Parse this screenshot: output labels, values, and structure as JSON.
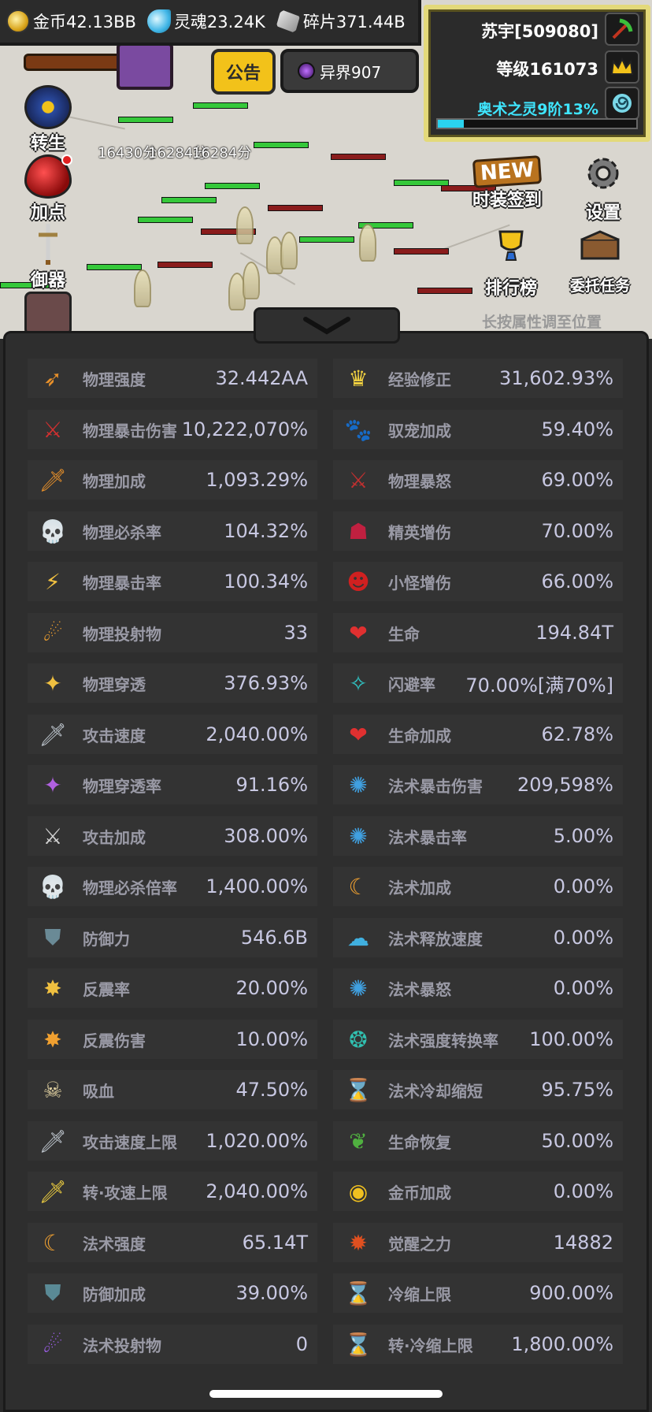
{
  "resources": {
    "gold": "金币42.13BB",
    "soul": "灵魂23.24K",
    "fragment": "碎片371.44B"
  },
  "player": {
    "name": "苏宇[509080]",
    "level": "等级161073",
    "arcane": "奥术之灵9阶13%",
    "arcane_progress": 0.13
  },
  "buttons": {
    "notice": "公告",
    "realm": "异界907",
    "rebirth": "转生",
    "add_points": "加点",
    "weapon": "御器",
    "new_tag": "NEW",
    "fashion_signin": "时装签到",
    "settings": "设置",
    "ranking": "排行榜",
    "commission": "委托任务"
  },
  "scene": {
    "damage_texts": [
      "16430分",
      "16284分",
      "16284分"
    ],
    "hint": "长按属性调至位置"
  },
  "stats_left": [
    {
      "icon": "phys-strength-icon",
      "glyph": "➶",
      "color": "#e8902a",
      "label": "物理强度",
      "value": "32.442AA"
    },
    {
      "icon": "phys-crit-damage-icon",
      "glyph": "⚔",
      "color": "#d03030",
      "label": "物理暴击伤害",
      "value": "10,222,070%"
    },
    {
      "icon": "phys-bonus-icon",
      "glyph": "🗡",
      "color": "#e8902a",
      "label": "物理加成",
      "value": "1,093.29%"
    },
    {
      "icon": "phys-kill-rate-icon",
      "glyph": "💀",
      "color": "#e0d0a0",
      "label": "物理必杀率",
      "value": "104.32%"
    },
    {
      "icon": "phys-crit-rate-icon",
      "glyph": "⚡",
      "color": "#f0c040",
      "label": "物理暴击率",
      "value": "100.34%"
    },
    {
      "icon": "phys-projectile-icon",
      "glyph": "☄",
      "color": "#f0a030",
      "label": "物理投射物",
      "value": "33"
    },
    {
      "icon": "phys-penetration-icon",
      "glyph": "✦",
      "color": "#f0c040",
      "label": "物理穿透",
      "value": "376.93%"
    },
    {
      "icon": "attack-speed-icon",
      "glyph": "🗡",
      "color": "#c0c8d0",
      "label": "攻击速度",
      "value": "2,040.00%"
    },
    {
      "icon": "phys-pen-rate-icon",
      "glyph": "✦",
      "color": "#b060e0",
      "label": "物理穿透率",
      "value": "91.16%"
    },
    {
      "icon": "attack-bonus-icon",
      "glyph": "⚔",
      "color": "#d0d0d0",
      "label": "攻击加成",
      "value": "308.00%"
    },
    {
      "icon": "phys-kill-multiplier-icon",
      "glyph": "💀",
      "color": "#e0d0a0",
      "label": "物理必杀倍率",
      "value": "1,400.00%"
    },
    {
      "icon": "defense-icon",
      "glyph": "⛊",
      "color": "#6a8a96",
      "label": "防御力",
      "value": "546.6B"
    },
    {
      "icon": "reflect-rate-icon",
      "glyph": "✸",
      "color": "#f0c040",
      "label": "反震率",
      "value": "20.00%"
    },
    {
      "icon": "reflect-damage-icon",
      "glyph": "✸",
      "color": "#f0a030",
      "label": "反震伤害",
      "value": "10.00%"
    },
    {
      "icon": "lifesteal-icon",
      "glyph": "☠",
      "color": "#e0d0a0",
      "label": "吸血",
      "value": "47.50%"
    },
    {
      "icon": "attack-speed-cap-icon",
      "glyph": "🗡",
      "color": "#c0c8d0",
      "label": "攻击速度上限",
      "value": "1,020.00%"
    },
    {
      "icon": "trans-attack-speed-cap-icon",
      "glyph": "🗡",
      "color": "#f0d040",
      "label": "转·攻速上限",
      "value": "2,040.00%"
    },
    {
      "icon": "spell-power-icon",
      "glyph": "☾",
      "color": "#f0a030",
      "label": "法术强度",
      "value": "65.14T"
    },
    {
      "icon": "defense-bonus-icon",
      "glyph": "⛊",
      "color": "#5a8a96",
      "label": "防御加成",
      "value": "39.00%"
    },
    {
      "icon": "spell-projectile-icon",
      "glyph": "☄",
      "color": "#a060f0",
      "label": "法术投射物",
      "value": "0"
    }
  ],
  "stats_right": [
    {
      "icon": "exp-modifier-icon",
      "glyph": "♛",
      "color": "#f0d040",
      "label": "经验修正",
      "value": "31,602.93%"
    },
    {
      "icon": "pet-bonus-icon",
      "glyph": "🐾",
      "color": "#c08040",
      "label": "驭宠加成",
      "value": "59.40%"
    },
    {
      "icon": "phys-fury-icon",
      "glyph": "⚔",
      "color": "#c03030",
      "label": "物理暴怒",
      "value": "69.00%"
    },
    {
      "icon": "elite-damage-icon",
      "glyph": "☗",
      "color": "#c02040",
      "label": "精英增伤",
      "value": "70.00%"
    },
    {
      "icon": "minion-damage-icon",
      "glyph": "☻",
      "color": "#d02020",
      "label": "小怪增伤",
      "value": "66.00%"
    },
    {
      "icon": "health-icon",
      "glyph": "❤",
      "color": "#e03030",
      "label": "生命",
      "value": "194.84T"
    },
    {
      "icon": "dodge-rate-icon",
      "glyph": "✧",
      "color": "#30c0c0",
      "label": "闪避率",
      "value": "70.00%[满70%]"
    },
    {
      "icon": "health-bonus-icon",
      "glyph": "❤",
      "color": "#e03030",
      "label": "生命加成",
      "value": "62.78%"
    },
    {
      "icon": "spell-crit-damage-icon",
      "glyph": "✺",
      "color": "#40a0e0",
      "label": "法术暴击伤害",
      "value": "209,598%"
    },
    {
      "icon": "spell-crit-rate-icon",
      "glyph": "✺",
      "color": "#40a0e0",
      "label": "法术暴击率",
      "value": "5.00%"
    },
    {
      "icon": "spell-bonus-icon",
      "glyph": "☾",
      "color": "#f0a030",
      "label": "法术加成",
      "value": "0.00%"
    },
    {
      "icon": "cast-speed-icon",
      "glyph": "☁",
      "color": "#40b0e0",
      "label": "法术释放速度",
      "value": "0.00%"
    },
    {
      "icon": "spell-fury-icon",
      "glyph": "✺",
      "color": "#40a0e0",
      "label": "法术暴怒",
      "value": "0.00%"
    },
    {
      "icon": "spell-conversion-icon",
      "glyph": "❂",
      "color": "#30c0b0",
      "label": "法术强度转换率",
      "value": "100.00%"
    },
    {
      "icon": "spell-cooldown-icon",
      "glyph": "⌛",
      "color": "#c09060",
      "label": "法术冷却缩短",
      "value": "95.75%"
    },
    {
      "icon": "health-regen-icon",
      "glyph": "❦",
      "color": "#50b040",
      "label": "生命恢复",
      "value": "50.00%"
    },
    {
      "icon": "gold-bonus-icon",
      "glyph": "◉",
      "color": "#f0c020",
      "label": "金币加成",
      "value": "0.00%"
    },
    {
      "icon": "awakening-power-icon",
      "glyph": "✹",
      "color": "#e05020",
      "label": "觉醒之力",
      "value": "14882"
    },
    {
      "icon": "cooldown-cap-icon",
      "glyph": "⌛",
      "color": "#c09060",
      "label": "冷缩上限",
      "value": "900.00%"
    },
    {
      "icon": "trans-cooldown-cap-icon",
      "glyph": "⌛",
      "color": "#c09060",
      "label": "转·冷缩上限",
      "value": "1,800.00%"
    }
  ]
}
